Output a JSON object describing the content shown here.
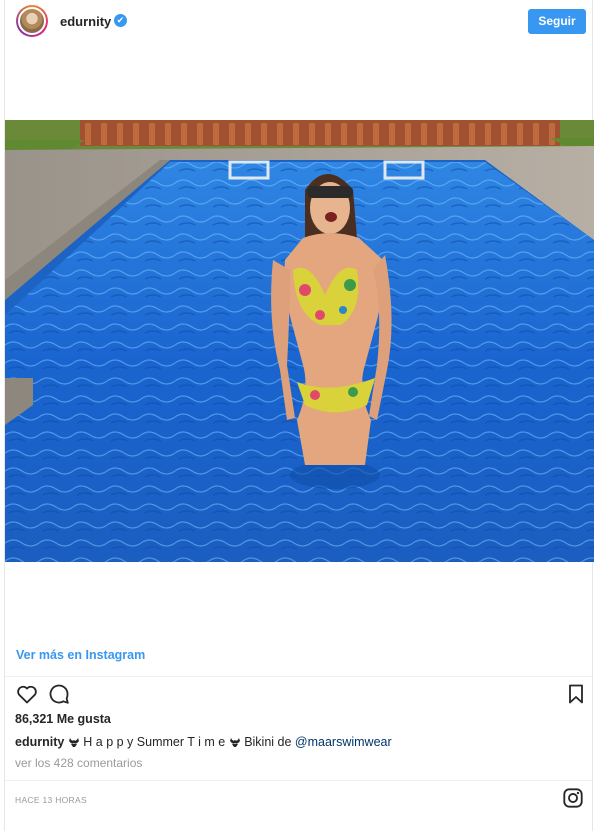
{
  "header": {
    "username": "edurnity",
    "verified_mark": "✔",
    "follow_label": "Seguir"
  },
  "post": {
    "view_more_label": "Ver más en Instagram",
    "likes_text": "86,321 Me gusta",
    "caption": {
      "username": "edurnity",
      "text_part1": "H a p p y Summer T i m e",
      "text_part2": " Bikini de ",
      "mention": "@maarswimwear"
    },
    "comments_label": "ver los 428 comentarios",
    "timestamp": "HACE 13 HORAS"
  },
  "icons": {
    "like": "heart-icon",
    "comment": "comment-icon",
    "save": "bookmark-icon",
    "brand": "instagram-icon"
  },
  "colors": {
    "accent": "#3897f0",
    "text": "#262626",
    "muted": "#999999",
    "mention": "#003569"
  }
}
